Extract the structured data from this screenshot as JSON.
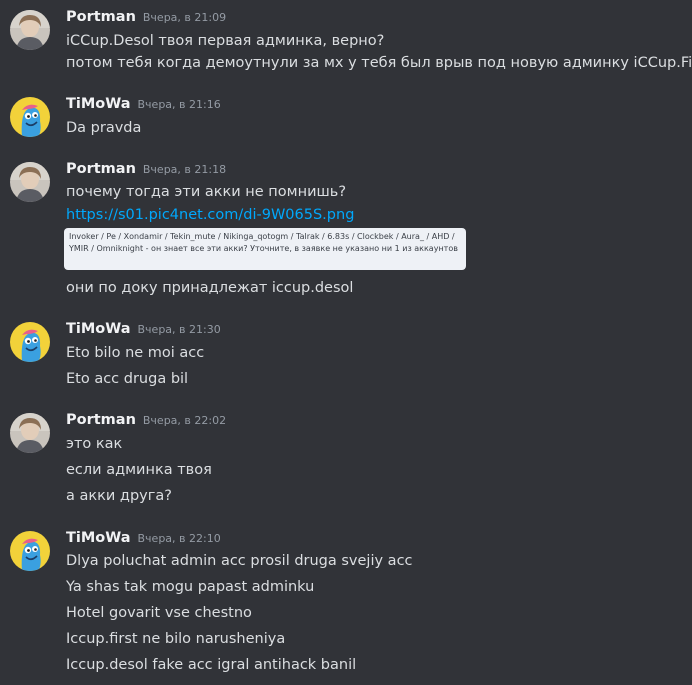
{
  "messages": [
    {
      "author": "Portman",
      "avatar": "portrait-avatar",
      "timestamp": "Вчера, в 21:09",
      "lines": [
        "iCCup.Desol твоя первая админка, верно?",
        "потом тебя когда демоутнули за мх у тебя был врыв под новую админку iCCup.First?"
      ]
    },
    {
      "author": "TiMoWa",
      "avatar": "blue-creature-avatar",
      "timestamp": "Вчера, в 21:16",
      "lines": [
        "Da pravda"
      ]
    },
    {
      "author": "Portman",
      "avatar": "portrait-avatar",
      "timestamp": "Вчера, в 21:18",
      "lines": [
        "почему тогда эти акки не помнишь?"
      ],
      "link": "https://s01.pic4net.com/di-9W065S.png",
      "embed_text": "Invoker / Pe / Xondamir / Tekin_mute / Nikinga_qotogm / Talrak / 6.83s / Clockbek / Aura_ / AHD / YMIR / Omniknight - он знает все эти акки? Уточните, в заявке не указано ни 1 из аккаунтов",
      "after_lines": [
        "они по доку принадлежат iccup.desol"
      ]
    },
    {
      "author": "TiMoWa",
      "avatar": "blue-creature-avatar",
      "timestamp": "Вчера, в 21:30",
      "lines": [
        "Eto bilo ne moi acc",
        "Eto acc druga bil"
      ]
    },
    {
      "author": "Portman",
      "avatar": "portrait-avatar",
      "timestamp": "Вчера, в 22:02",
      "lines": [
        "это как",
        "если админка твоя",
        "а акки друга?"
      ]
    },
    {
      "author": "TiMoWa",
      "avatar": "blue-creature-avatar",
      "timestamp": "Вчера, в 22:10",
      "lines": [
        "Dlya poluchat admin acc prosil druga svejiy acc",
        "Ya shas tak mogu papast adminku",
        "Hotel govarit vse chestno",
        "Iccup.first ne bilo narusheniya",
        "Iccup.desol fake acc igral antihack banil"
      ]
    }
  ],
  "colors": {
    "background": "#313338",
    "username": "#f2f3f5",
    "text": "#dbdee1",
    "timestamp": "#949ba4",
    "link": "#00a8fc"
  }
}
